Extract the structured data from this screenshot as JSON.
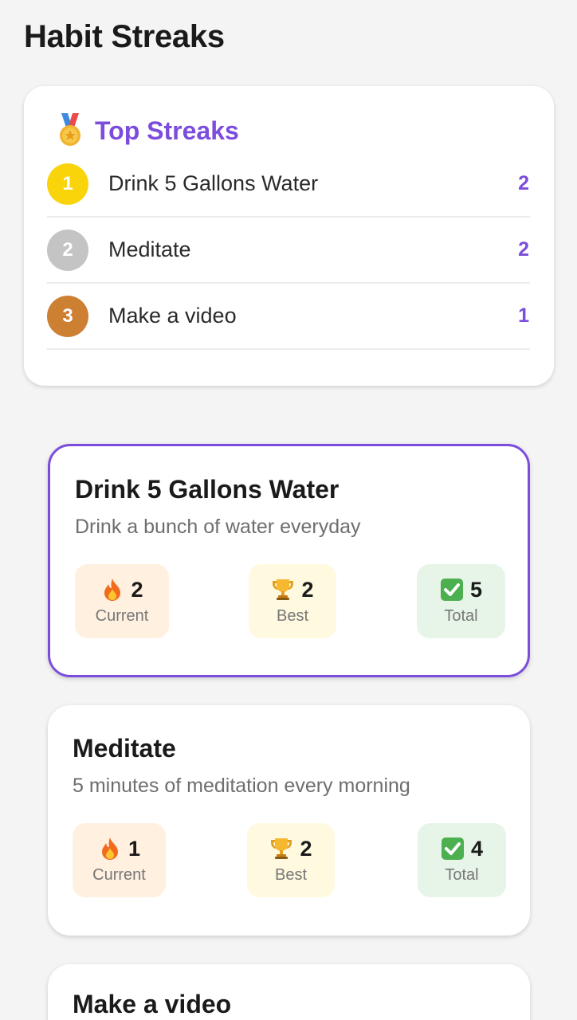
{
  "header": {
    "title": "Habit Streaks"
  },
  "top_streaks": {
    "title": "Top Streaks",
    "icon": "medal-icon",
    "items": [
      {
        "rank": "1",
        "name": "Drink 5 Gallons Water",
        "count": "2",
        "badge_color": "#f9d40b"
      },
      {
        "rank": "2",
        "name": "Meditate",
        "count": "2",
        "badge_color": "#c4c4c4"
      },
      {
        "rank": "3",
        "name": "Make a video",
        "count": "1",
        "badge_color": "#cd7f32"
      }
    ]
  },
  "habits": [
    {
      "name": "Drink 5 Gallons Water",
      "description": "Drink a bunch of water everyday",
      "selected": true,
      "current": "2",
      "current_label": "Current",
      "best": "2",
      "best_label": "Best",
      "total": "5",
      "total_label": "Total"
    },
    {
      "name": "Meditate",
      "description": "5 minutes of meditation every morning",
      "selected": false,
      "current": "1",
      "current_label": "Current",
      "best": "2",
      "best_label": "Best",
      "total": "4",
      "total_label": "Total"
    },
    {
      "name": "Make a video"
    }
  ],
  "colors": {
    "accent": "#7c4ddc",
    "current_bg": "#fff0e0",
    "best_bg": "#fff9e0",
    "total_bg": "#e7f5e8"
  },
  "stat_icons": {
    "current": "fire-icon",
    "best": "trophy-icon",
    "total": "check-mark-icon"
  }
}
